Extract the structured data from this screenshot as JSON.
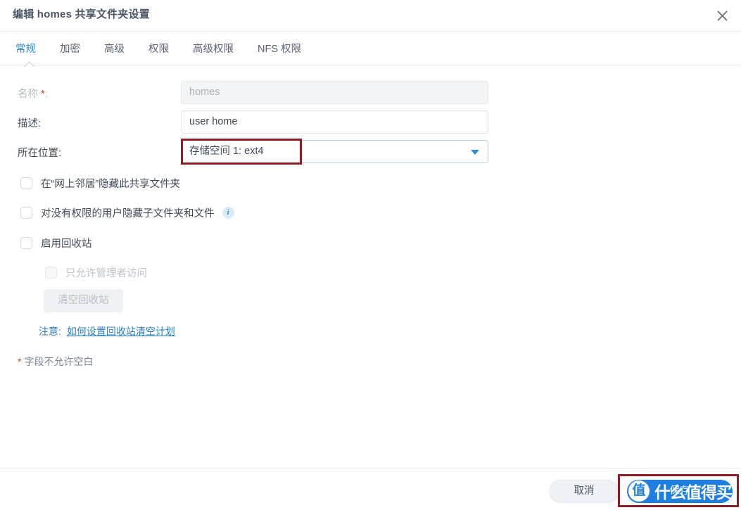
{
  "window": {
    "title": "编辑 homes 共享文件夹设置",
    "close_icon": "close-icon"
  },
  "tabs": [
    {
      "label": "常规",
      "active": true
    },
    {
      "label": "加密",
      "active": false
    },
    {
      "label": "高级",
      "active": false
    },
    {
      "label": "权限",
      "active": false
    },
    {
      "label": "高级权限",
      "active": false
    },
    {
      "label": "NFS 权限",
      "active": false
    }
  ],
  "form": {
    "name": {
      "label": "名称",
      "required_mark": "*",
      "colon": ":",
      "value": "homes",
      "readonly": true
    },
    "description": {
      "label": "描述:",
      "value": "user home"
    },
    "location": {
      "label": "所在位置:",
      "value": "存储空间 1:  ext4"
    }
  },
  "checkboxes": [
    {
      "label": "在“网上邻居”隐藏此共享文件夹",
      "checked": false,
      "disabled": false,
      "info": false
    },
    {
      "label": "对没有权限的用户隐藏子文件夹和文件",
      "checked": false,
      "disabled": false,
      "info": true
    },
    {
      "label": "启用回收站",
      "checked": false,
      "disabled": false,
      "info": false
    },
    {
      "label": "只允许管理者访问",
      "checked": false,
      "disabled": true,
      "info": false
    }
  ],
  "recycle": {
    "empty_button": "清空回收站",
    "note_label": "注意:",
    "note_link": "如何设置回收站清空计划"
  },
  "footnote": {
    "star": "*",
    "text": "字段不允许空白"
  },
  "footer": {
    "cancel": "取消",
    "save": "保存"
  },
  "watermark": {
    "badge": "值",
    "text": "什么值得买"
  },
  "colors": {
    "accent": "#2a8ce0",
    "primary_button": "#1f7fe0",
    "annotation": "#8e1c24",
    "required": "#d0402e",
    "link": "#2a7fc4"
  }
}
